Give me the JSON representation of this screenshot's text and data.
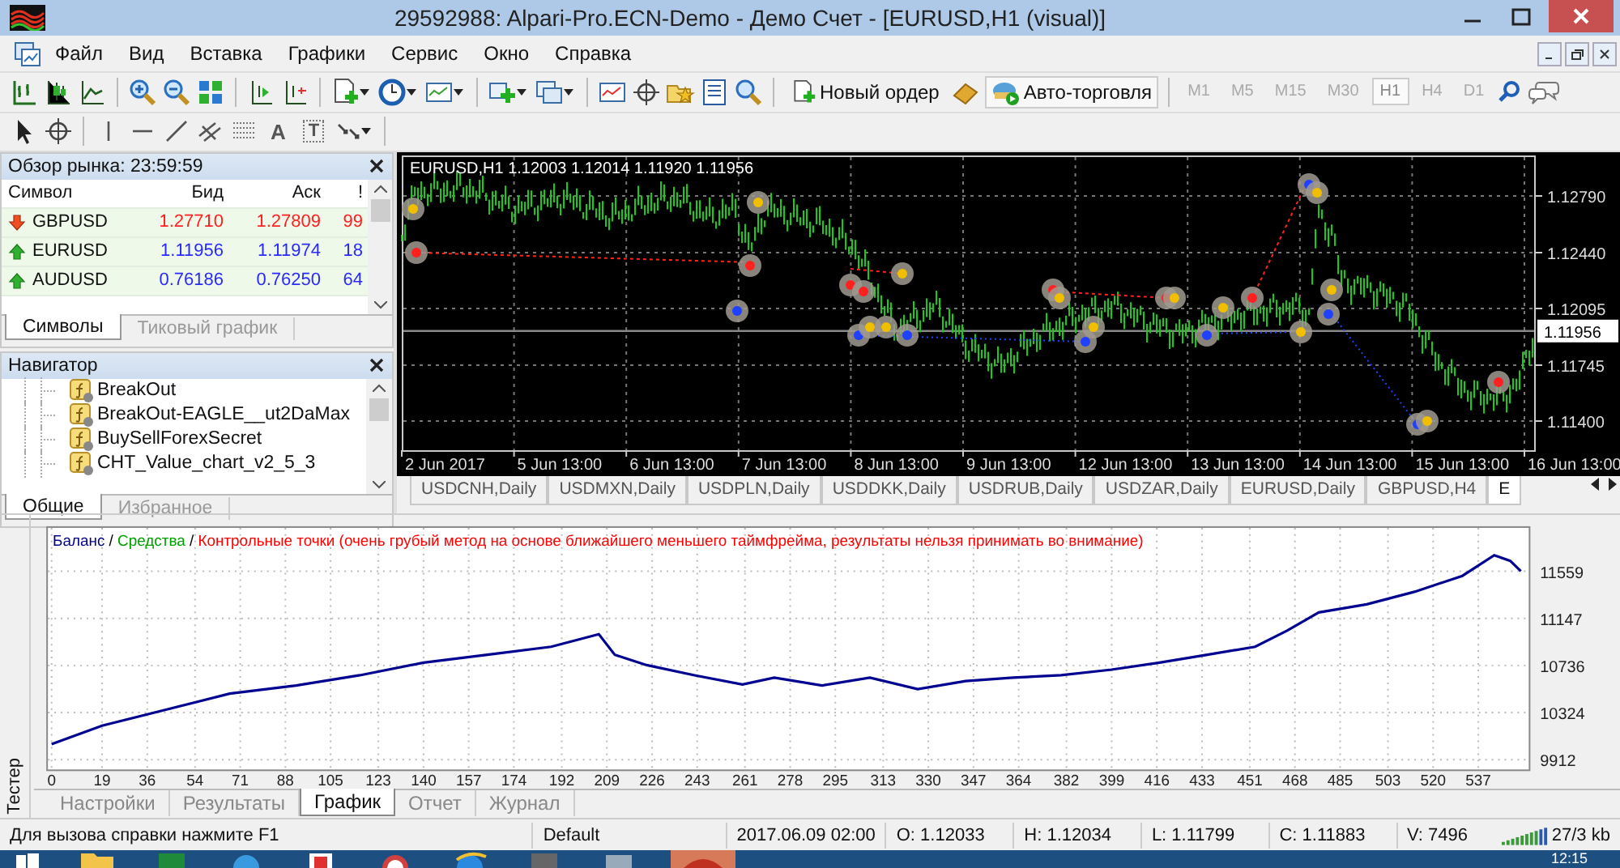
{
  "window": {
    "title": "29592988: Alpari-Pro.ECN-Demo - Демо Счет - [EURUSD,H1 (visual)]"
  },
  "menu": [
    "Файл",
    "Вид",
    "Вставка",
    "Графики",
    "Сервис",
    "Окно",
    "Справка"
  ],
  "toolbar": {
    "new_order": "Новый ордер",
    "auto_trading": "Авто-торговля",
    "timeframes": [
      {
        "label": "M1",
        "selected": false
      },
      {
        "label": "M5",
        "selected": false
      },
      {
        "label": "M15",
        "selected": false
      },
      {
        "label": "M30",
        "selected": false
      },
      {
        "label": "H1",
        "selected": true
      },
      {
        "label": "H4",
        "selected": false
      },
      {
        "label": "D1",
        "selected": false
      }
    ]
  },
  "drawing_toolbar": {
    "text_tool": "A",
    "label_tool": "T"
  },
  "market_watch": {
    "title": "Обзор рынка: 23:59:59",
    "columns": [
      "Символ",
      "Бид",
      "Аск",
      "!"
    ],
    "rows": [
      {
        "symbol": "GBPUSD",
        "bid": "1.27710",
        "ask": "1.27809",
        "spread": "99",
        "rising": false
      },
      {
        "symbol": "EURUSD",
        "bid": "1.11956",
        "ask": "1.11974",
        "spread": "18",
        "rising": true
      },
      {
        "symbol": "AUDUSD",
        "bid": "0.76186",
        "ask": "0.76250",
        "spread": "64",
        "rising": true
      }
    ],
    "tabs": [
      {
        "label": "Символы",
        "selected": true
      },
      {
        "label": "Тиковый график",
        "selected": false
      }
    ]
  },
  "navigator": {
    "title": "Навигатор",
    "items": [
      "BreakOut",
      "BreakOut-EAGLE__ut2DaMax",
      "BuySellForexSecret",
      "CHT_Value_chart_v2_5_3"
    ],
    "tabs": [
      {
        "label": "Общие",
        "selected": true
      },
      {
        "label": "Избранное",
        "selected": false
      }
    ]
  },
  "price_chart": {
    "header": "EURUSD,H1  1.12003 1.12014 1.11920 1.11956",
    "price_labels": [
      "1.12790",
      "1.12440",
      "1.12095",
      "1.11745",
      "1.11400"
    ],
    "current_price": "1.11956",
    "time_labels": [
      "2 Jun 2017",
      "5 Jun 13:00",
      "6 Jun 13:00",
      "7 Jun 13:00",
      "8 Jun 13:00",
      "9 Jun 13:00",
      "12 Jun 13:00",
      "13 Jun 13:00",
      "14 Jun 13:00",
      "15 Jun 13:00",
      "16 Jun 13:00"
    ]
  },
  "chart_tabs": [
    {
      "label": "USDCNH,Daily",
      "selected": false
    },
    {
      "label": "USDMXN,Daily",
      "selected": false
    },
    {
      "label": "USDPLN,Daily",
      "selected": false
    },
    {
      "label": "USDDKK,Daily",
      "selected": false
    },
    {
      "label": "USDRUB,Daily",
      "selected": false
    },
    {
      "label": "USDZAR,Daily",
      "selected": false
    },
    {
      "label": "EURUSD,Daily",
      "selected": false
    },
    {
      "label": "GBPUSD,H4",
      "selected": false
    },
    {
      "label": "E",
      "selected": true
    }
  ],
  "tester": {
    "side_label": "Тестер",
    "legend": [
      {
        "text": " / ",
        "color": "#000000"
      },
      {
        "text": "Средства",
        "color": "#00a000"
      },
      {
        "text": " / ",
        "color": "#000000"
      },
      {
        "text": "Контрольные точки (очень грубый метод на основе ближайшего меньшего таймфрейма, результаты нельзя принимать во внимание)",
        "color": "#ff0000"
      }
    ],
    "chart_data": {
      "type": "line",
      "x": [
        0,
        19,
        43,
        67,
        92,
        116,
        140,
        164,
        188,
        206,
        212,
        224,
        242,
        260,
        272,
        290,
        308,
        326,
        344,
        362,
        380,
        399,
        417,
        435,
        453,
        465,
        477,
        495,
        513,
        531,
        543,
        549,
        553
      ],
      "series": [
        {
          "name": "Баланс",
          "color": "#000090",
          "values": [
            10050,
            10210,
            10350,
            10490,
            10560,
            10650,
            10760,
            10830,
            10900,
            11010,
            10830,
            10740,
            10650,
            10570,
            10630,
            10560,
            10630,
            10530,
            10600,
            10630,
            10650,
            10700,
            10760,
            10830,
            10900,
            11040,
            11200,
            11270,
            11380,
            11520,
            11700,
            11650,
            11560
          ]
        }
      ],
      "xlim": [
        -2,
        556
      ],
      "ylim": [
        9827,
        11953
      ],
      "grid": true,
      "xticks": [
        0,
        19,
        36,
        54,
        71,
        88,
        105,
        123,
        140,
        157,
        174,
        192,
        209,
        226,
        243,
        261,
        278,
        295,
        313,
        330,
        347,
        364,
        382,
        399,
        416,
        433,
        451,
        468,
        485,
        503,
        520,
        537
      ],
      "yticks": [
        9912,
        10324,
        10736,
        11147,
        11559
      ]
    },
    "tabs": [
      {
        "label": "Настройки",
        "selected": false
      },
      {
        "label": "Результаты",
        "selected": false
      },
      {
        "label": "График",
        "selected": true
      },
      {
        "label": "Отчет",
        "selected": false
      },
      {
        "label": "Журнал",
        "selected": false
      }
    ]
  },
  "status_bar": {
    "help": "Для вызова справки нажмите F1",
    "profile": "Default",
    "time": "2017.06.09 02:00",
    "open": "O: 1.12033",
    "high": "H: 1.12034",
    "low": "L: 1.11799",
    "close": "C: 1.11883",
    "volume": "V: 7496",
    "traffic": "27/3 kb"
  },
  "taskbar": {
    "clock": "12:15"
  }
}
